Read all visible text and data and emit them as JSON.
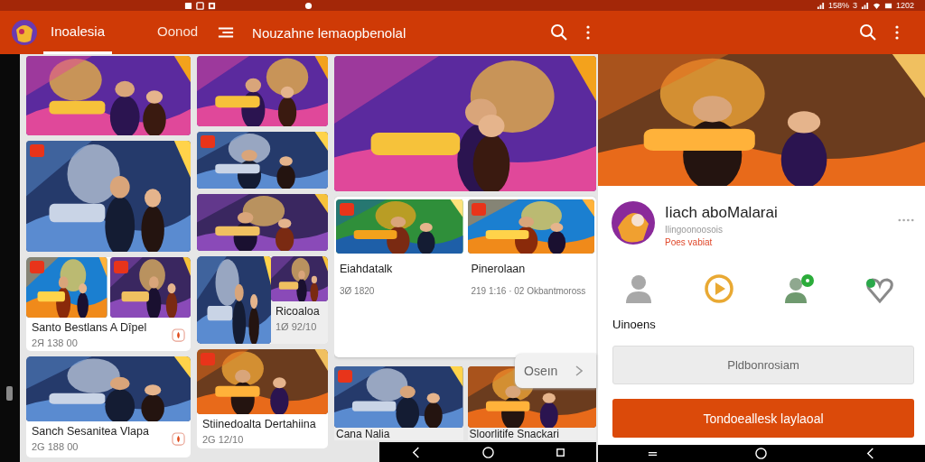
{
  "status_bar": {
    "signal_count": "3",
    "battery": "158%",
    "time": "1202"
  },
  "app_bar": {
    "tabs": [
      {
        "label": "Inoalesia",
        "selected": true
      },
      {
        "label": "Oonod",
        "selected": false
      }
    ],
    "title": "Nouzahne lemaopbenolal"
  },
  "columns": [
    {
      "tiles": [
        {
          "kind": "picture",
          "badge": false
        },
        {
          "kind": "picture",
          "badge": true
        },
        {
          "kind": "split_card",
          "badge": true,
          "title": "Santo Bestlans A Dîpel",
          "meta": "2Я 138 00"
        },
        {
          "kind": "card",
          "badge": false,
          "title": "Sanch Sesanitea Vlapa",
          "meta": "2G 188 00"
        }
      ]
    },
    {
      "tiles": [
        {
          "kind": "picture",
          "badge": false
        },
        {
          "kind": "picture",
          "badge": true
        },
        {
          "kind": "picture",
          "badge": false
        },
        {
          "kind": "side_card",
          "badge": false,
          "title": "Ricoaloa",
          "meta": "1Ø 92/10"
        },
        {
          "kind": "card",
          "badge": true,
          "title": "Stiinedoalta Dertahiina",
          "meta": "2G 12/10"
        }
      ]
    },
    {
      "tiles": [
        {
          "kind": "picture",
          "badge": false
        },
        {
          "kind": "panel",
          "items": [
            {
              "badge": true,
              "title": "Eiahdatalk",
              "meta": "3Ø 1820"
            },
            {
              "badge": true,
              "title": "Pinerolaan",
              "meta": "219 1:16 · 02 Okbantmoross"
            }
          ]
        },
        {
          "kind": "pair",
          "items": [
            {
              "badge": true,
              "title": "Cana Nalia"
            },
            {
              "badge": false,
              "title": "Sloorlitife Snackari"
            }
          ]
        }
      ]
    }
  ],
  "open_chip": {
    "label": "Oseın"
  },
  "detail": {
    "title": "Iiach aboMalarai",
    "developer": "Ilingoonoosois",
    "tag": "Poes vabiat",
    "action_label": "Uinoens",
    "secondary_button": "Pldbonrosiam",
    "primary_button": "Tondoeallesk laylaoal"
  }
}
